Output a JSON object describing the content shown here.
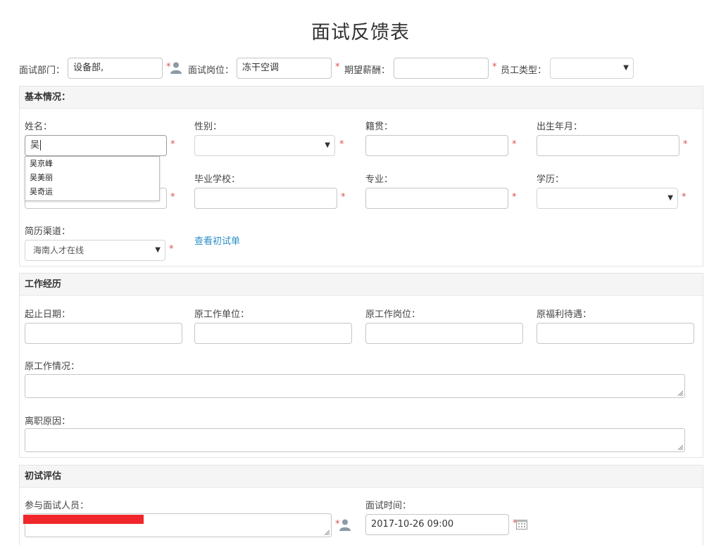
{
  "page_title": "面试反馈表",
  "top": {
    "dept_label": "面试部门：",
    "dept_value": "设备部,",
    "position_label": "面试岗位：",
    "position_value": "冻干空调",
    "salary_label": "期望薪酬：",
    "salary_value": "",
    "emp_type_label": "员工类型：",
    "emp_type_value": ""
  },
  "basic": {
    "header": "基本情况：",
    "name_label": "姓名：",
    "name_value": "吴",
    "gender_label": "性别：",
    "origin_label": "籍贯：",
    "birth_label": "出生年月：",
    "school_label": "毕业学校：",
    "major_label": "专业：",
    "edu_label": "学历：",
    "resume_label": "简历渠道：",
    "resume_value": "海南人才在线",
    "view_link": "查看初试单",
    "suggestions": [
      "吴京峰",
      "吴美丽",
      "吴奇运"
    ]
  },
  "work": {
    "header": "工作经历",
    "dates_label": "起止日期：",
    "employer_label": "原工作单位：",
    "job_label": "原工作岗位：",
    "benefits_label": "原福利待遇：",
    "situation_label": "原工作情况：",
    "leave_label": "离职原因："
  },
  "eval": {
    "header": "初试评估",
    "participants_label": "参与面试人员：",
    "time_label": "面试时间：",
    "time_value": "2017-10-26 09:00"
  },
  "required_mark": "*",
  "dropdown_arrow": "▼",
  "icons": {
    "user": "user-icon",
    "calendar": "calendar-icon"
  },
  "colors": {
    "required": "#d9534f",
    "link": "#2a8dc8",
    "panel_head": "#f5f5f5"
  }
}
